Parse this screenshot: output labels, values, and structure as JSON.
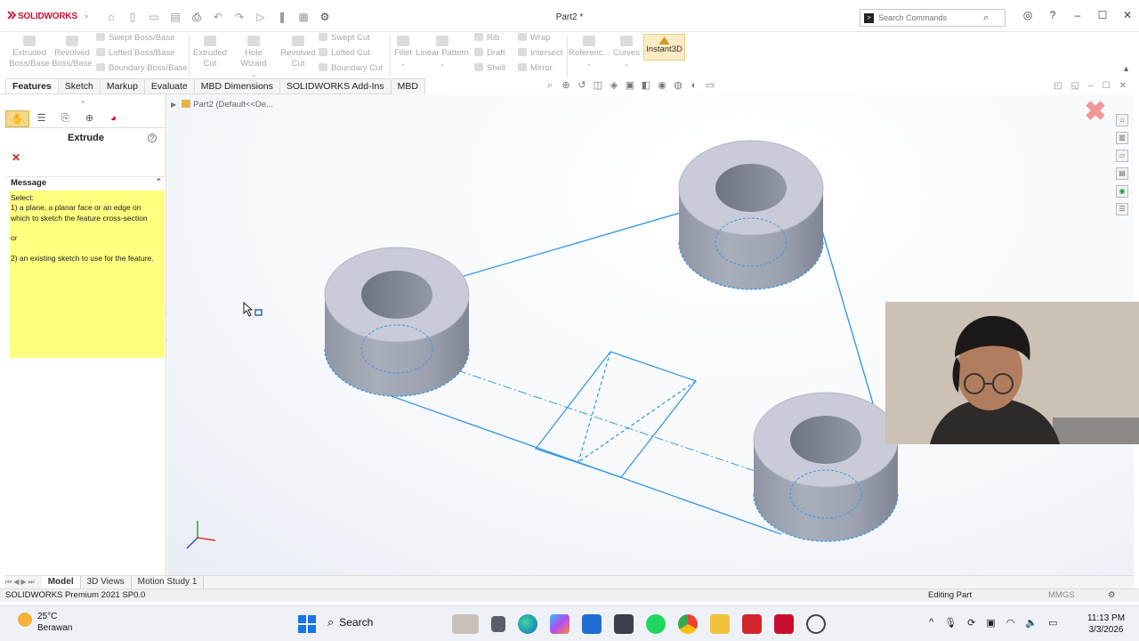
{
  "app": {
    "logo_text": "SOLIDWORKS",
    "doc_title": "Part2 *",
    "search_placeholder": "Search Commands"
  },
  "commands": {
    "extruded_boss": "Extruded Boss/Base",
    "revolved_boss": "Revolved Boss/Base",
    "swept_boss": "Swept Boss/Base",
    "lofted_boss": "Lofted Boss/Base",
    "boundary_boss": "Boundary Boss/Base",
    "extruded_cut": "Extruded Cut",
    "hole_wizard": "Hole Wizard",
    "revolved_cut": "Revolved Cut",
    "swept_cut": "Swept Cut",
    "lofted_cut": "Lofted Cut",
    "boundary_cut": "Boundary Cut",
    "fillet": "Fillet",
    "linear_pattern": "Linear Pattern",
    "rib": "Rib",
    "draft": "Draft",
    "shell": "Shell",
    "wrap": "Wrap",
    "intersect": "Intersect",
    "mirror": "Mirror",
    "reference": "Referenc...",
    "curves": "Curves",
    "instant3d": "Instant3D"
  },
  "tabs": [
    "Features",
    "Sketch",
    "Markup",
    "Evaluate",
    "MBD Dimensions",
    "SOLIDWORKS Add-Ins",
    "MBD"
  ],
  "property_manager": {
    "title": "Extrude",
    "message_header": "Message",
    "message_lines": [
      "Select:",
      "1) a plane, a planar face or an edge on",
      "which to sketch the feature cross-section",
      "",
      "or",
      "",
      "2) an existing sketch to use for the feature."
    ]
  },
  "tree": {
    "root": "Part2 (Default<<De..."
  },
  "bottom_tabs": [
    "Model",
    "3D Views",
    "Motion Study 1"
  ],
  "status": {
    "version": "SOLIDWORKS Premium 2021 SP0.0",
    "mode": "Editing Part",
    "units": "MMGS"
  },
  "taskbar": {
    "temperature": "25°C",
    "weather": "Berawan",
    "search": "Search",
    "time": "11:13 PM",
    "date": "3/3/2026"
  },
  "colors": {
    "accent": "#1a73e8",
    "sketch_line": "#3b9ae1",
    "message_bg": "#ffff80",
    "solidworks_red": "#c8102e",
    "instant3d_bg": "#fcecc4"
  }
}
